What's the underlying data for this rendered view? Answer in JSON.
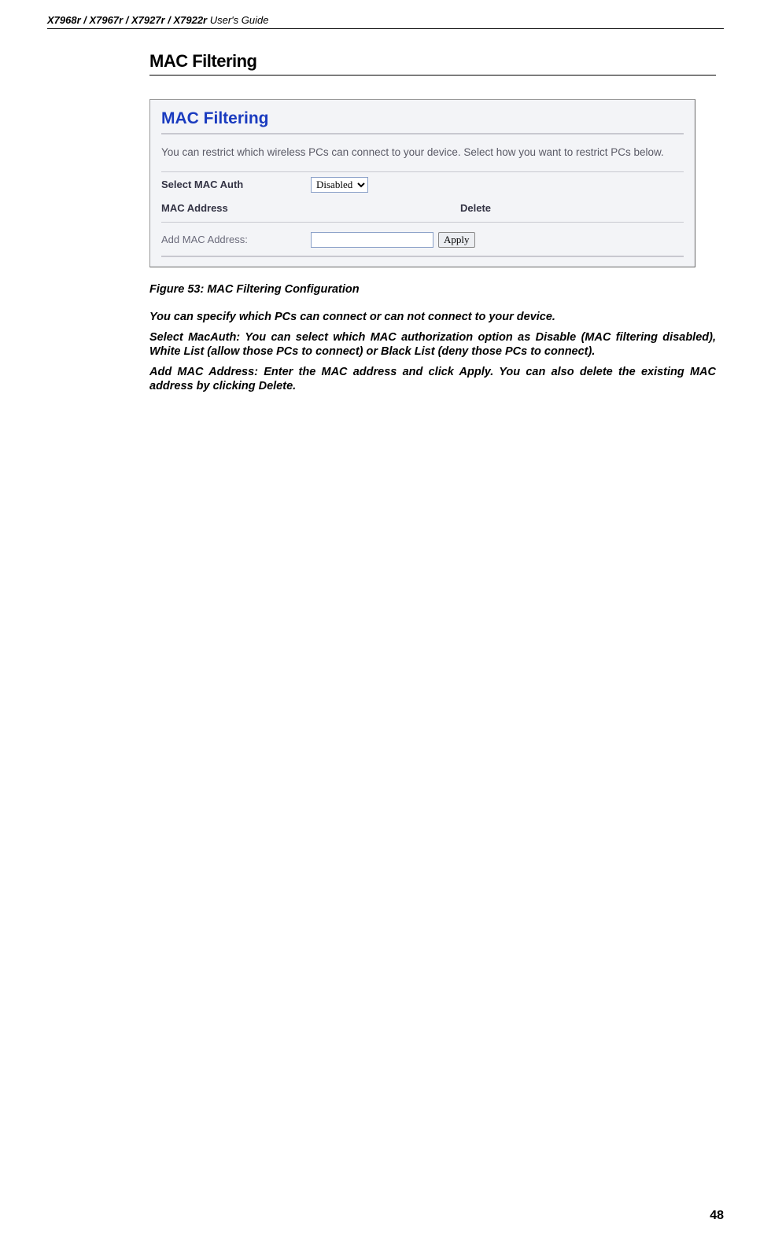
{
  "header": {
    "bold": "X7968r / X7967r / X7927r / X7922r",
    "rest": " User's Guide"
  },
  "section_title": "MAC Filtering",
  "screenshot": {
    "title": "MAC Filtering",
    "desc": "You can restrict which wireless PCs can connect to your device. Select how you want to restrict PCs below.",
    "select_label": "Select MAC Auth",
    "select_value": "Disabled",
    "mac_address_label": "MAC Address",
    "delete_label": "Delete",
    "add_label": "Add MAC Address:",
    "apply_label": "Apply"
  },
  "figure_caption": "Figure 53: MAC Filtering Configuration",
  "paragraphs": {
    "p1": "You can specify which PCs can connect or can not connect to your device.",
    "p2": "Select MacAuth: You can select which MAC authorization option as Disable (MAC filtering disabled), White List (allow those PCs to connect) or Black List (deny those PCs to connect).",
    "p3": "Add MAC Address: Enter the MAC address and click Apply. You can also delete the existing MAC address by clicking Delete."
  },
  "page_number": "48"
}
